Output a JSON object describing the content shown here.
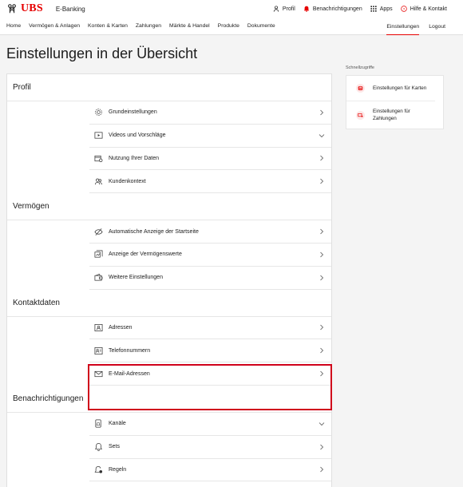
{
  "header": {
    "logo_text": "UBS",
    "app_name": "E-Banking",
    "links": [
      {
        "label": "Profil",
        "icon": "person-icon"
      },
      {
        "label": "Benachrichtigungen",
        "icon": "bell-icon"
      },
      {
        "label": "Apps",
        "icon": "grid-icon"
      },
      {
        "label": "Hilfe & Kontakt",
        "icon": "help-icon"
      }
    ]
  },
  "nav": {
    "items": [
      "Home",
      "Vermögen & Anlagen",
      "Konten & Karten",
      "Zahlungen",
      "Märkte & Handel",
      "Produkte",
      "Dokumente"
    ],
    "right": [
      "Einstellungen",
      "Logout"
    ],
    "active": "Einstellungen"
  },
  "page": {
    "title": "Einstellungen in der Übersicht"
  },
  "sections": [
    {
      "title": "Profil",
      "rows": [
        {
          "label": "Grundeinstellungen",
          "icon": "gear-icon",
          "chevron": "right"
        },
        {
          "label": "Videos und Vorschläge",
          "icon": "video-icon",
          "chevron": "down"
        },
        {
          "label": "Nutzung Ihrer Daten",
          "icon": "data-usage-icon",
          "chevron": "right"
        },
        {
          "label": "Kundenkontext",
          "icon": "people-icon",
          "chevron": "right"
        }
      ]
    },
    {
      "title": "Vermögen",
      "rows": [
        {
          "label": "Automatische Anzeige der Startseite",
          "icon": "eye-off-icon",
          "chevron": "right"
        },
        {
          "label": "Anzeige der Vermögenswerte",
          "icon": "assets-icon",
          "chevron": "right"
        },
        {
          "label": "Weitere Einstellungen",
          "icon": "wallet-icon",
          "chevron": "right"
        }
      ]
    },
    {
      "title": "Kontaktdaten",
      "rows": [
        {
          "label": "Adressen",
          "icon": "address-icon",
          "chevron": "right"
        },
        {
          "label": "Telefonnummern",
          "icon": "phone-card-icon",
          "chevron": "right"
        },
        {
          "label": "E-Mail-Adressen",
          "icon": "email-icon",
          "chevron": "right"
        }
      ]
    },
    {
      "title": "Benachrichtigungen",
      "rows": [
        {
          "label": "Kanäle",
          "icon": "channels-icon",
          "chevron": "down"
        },
        {
          "label": "Sets",
          "icon": "bell-icon",
          "chevron": "right"
        },
        {
          "label": "Regeln",
          "icon": "bell-rule-icon",
          "chevron": "right"
        }
      ]
    }
  ],
  "quick_access": {
    "label": "Schnellzugriffe",
    "items": [
      {
        "label": "Einstellungen für Karten",
        "icon": "card-icon"
      },
      {
        "label": "Einstellungen für Zahlungen",
        "icon": "payment-icon"
      }
    ]
  },
  "colors": {
    "brand_red": "#e60000",
    "highlight_border": "#d0021b",
    "quick_icon_bg": "#fde8e8"
  }
}
